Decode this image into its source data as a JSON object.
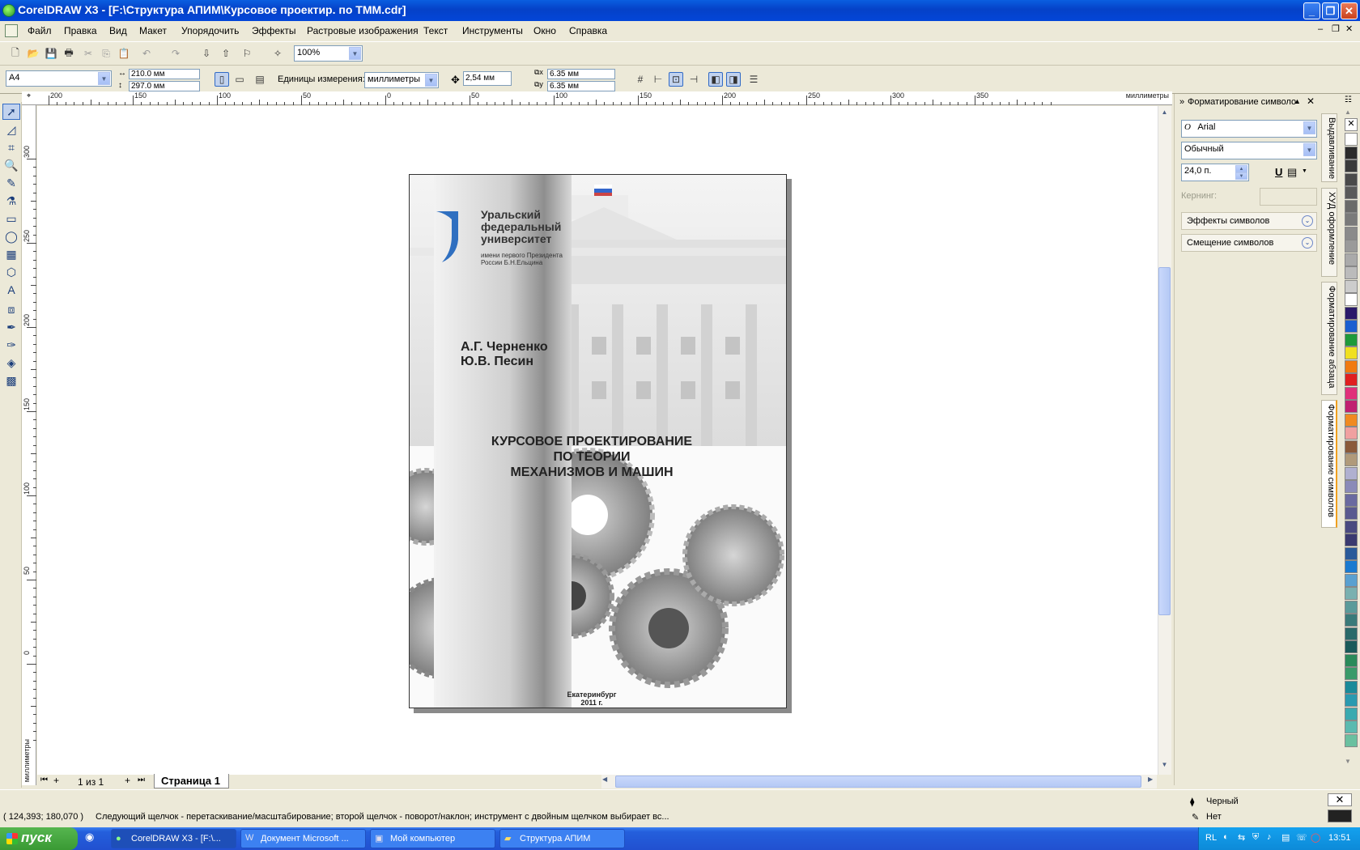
{
  "window": {
    "title": "CorelDRAW X3 - [F:\\Структура АПИМ\\Курсовое проектир. по ТММ.cdr]",
    "min": "_",
    "max": "❐",
    "close": "✕"
  },
  "menu": [
    "Файл",
    "Правка",
    "Вид",
    "Макет",
    "Упорядочить",
    "Эффекты",
    "Растровые изображения",
    "Текст",
    "Инструменты",
    "Окно",
    "Справка"
  ],
  "toolbar": {
    "zoom": "100%"
  },
  "property_bar": {
    "paper": "A4",
    "width": "210.0 мм",
    "height": "297.0 мм",
    "units_label": "Единицы измерения:",
    "units": "миллиметры",
    "nudge": "2,54 мм",
    "dup_x": "6.35 мм",
    "dup_y": "6.35 мм"
  },
  "ruler": {
    "h_labels": [
      "200",
      "150",
      "100",
      "50",
      "0",
      "50",
      "100",
      "150",
      "200",
      "250",
      "300",
      "350"
    ],
    "h_unit": "миллиметры",
    "v_labels": [
      "300",
      "250",
      "200",
      "150",
      "100",
      "50",
      "0"
    ],
    "v_unit": "миллиметры"
  },
  "document": {
    "university_line1": "Уральский",
    "university_line2": "федеральный",
    "university_line3": "университет",
    "university_sub1": "имени первого Президента",
    "university_sub2": "России Б.Н.Ельцина",
    "author1": "А.Г. Черненко",
    "author2": "Ю.В. Песин",
    "title_line1": "КУРСОВОЕ ПРОЕКТИРОВАНИЕ",
    "title_line2": "ПО ТЕОРИИ",
    "title_line3": "МЕХАНИЗМОВ И МАШИН",
    "city": "Екатеринбург",
    "year": "2011 г."
  },
  "page_nav": {
    "counter": "1 из 1",
    "tab": "Страница 1"
  },
  "docker": {
    "title": "Форматирование символо",
    "font": "Arial",
    "style": "Обычный",
    "size": "24,0 п.",
    "kerning_label": "Кернинг:",
    "effects": "Эффекты символов",
    "offset": "Смещение символов",
    "tabs": [
      "Выдавливание",
      "ХУД оформление",
      "Форматирование абзаца",
      "Форматирование символов"
    ]
  },
  "palette": [
    "#ffffff",
    "#2b2b2b",
    "#3a3a3a",
    "#4a4a4a",
    "#5a5a5a",
    "#6a6a6a",
    "#7a7a7a",
    "#8a8a8a",
    "#9a9a9a",
    "#aaaaaa",
    "#bbbbbb",
    "#cccccc",
    "#ffffff",
    "#2a1a6a",
    "#1a5fd0",
    "#1e9a3a",
    "#f0e020",
    "#f07a10",
    "#e02020",
    "#e0307a",
    "#c02070",
    "#f08a20",
    "#f0a0a0",
    "#8a5a3a",
    "#b09a7a",
    "#b0b0d0",
    "#8a8ab8",
    "#6a6aa0",
    "#5a5a90",
    "#4a4a80",
    "#3a3a70",
    "#2a5a9a",
    "#1a7ad0",
    "#5aa0d0",
    "#7ab0b0",
    "#5a9a9a",
    "#3a7a7a",
    "#2a6a6a",
    "#1a5a5a",
    "#2a8a5a",
    "#3a9a6a",
    "#1a8a9a",
    "#2a9ab0",
    "#3aaab0",
    "#5abab0",
    "#6ac0a0"
  ],
  "status": {
    "coords": "( 124,393; 180,070 )",
    "message": "Следующий щелчок - перетаскивание/масштабирование; второй щелчок - поворот/наклон; инструмент с двойным щелчком выбирает вс...",
    "fill_label": "Черный",
    "outline_label": "Нет"
  },
  "taskbar": {
    "start": "пуск",
    "tasks": [
      "CorelDRAW X3 - [F:\\...",
      "Документ Microsoft ...",
      "Мой компьютер",
      "Структура АПИМ"
    ],
    "lang": "RL",
    "clock": "13:51"
  }
}
